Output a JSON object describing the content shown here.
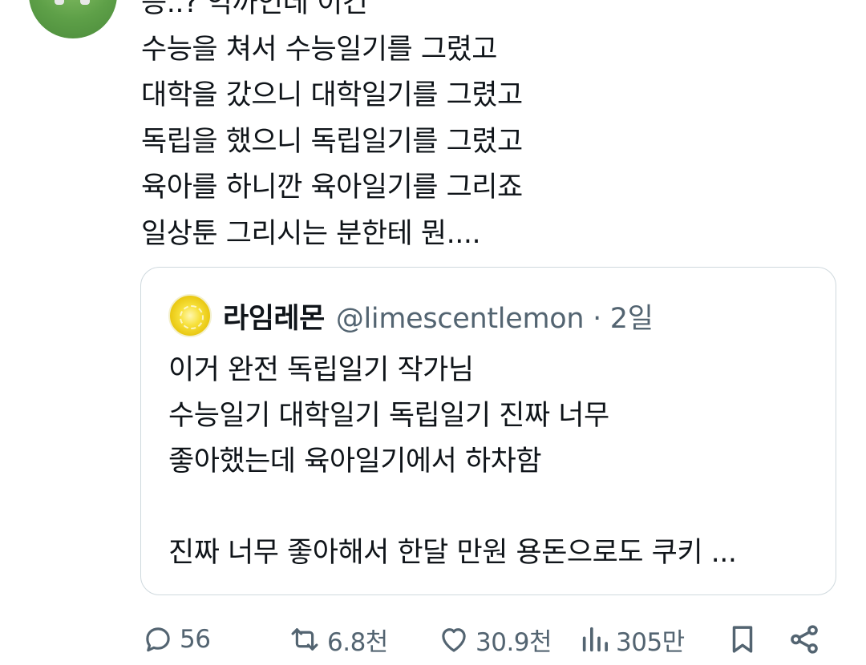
{
  "tweet": {
    "lines": [
      "응..? 억까인데 이건",
      "수능을 쳐서 수능일기를 그렸고",
      "대학을 갔으니 대학일기를 그렸고",
      "독립을 했으니 독립일기를 그렸고",
      "육아를 하니깐  육아일기를 그리죠",
      "일상툰 그리시는 분한테 뭔...."
    ]
  },
  "quote": {
    "name": "라임레몬",
    "handle": "@limescentlemon · 2일",
    "lines": [
      "이거 완전 독립일기 작가님",
      "수능일기 대학일기 독립일기 진짜 너무",
      "좋아했는데 육아일기에서 하차함",
      "",
      "진짜 너무 좋아해서 한달 만원 용돈으로도 쿠키 ..."
    ]
  },
  "actions": {
    "reply_count": "56",
    "retweet_count": "6.8천",
    "like_count": "30.9천",
    "view_count": "305만"
  },
  "colors": {
    "text": "#0f1419",
    "secondary": "#536471",
    "border": "#cfd9de"
  }
}
